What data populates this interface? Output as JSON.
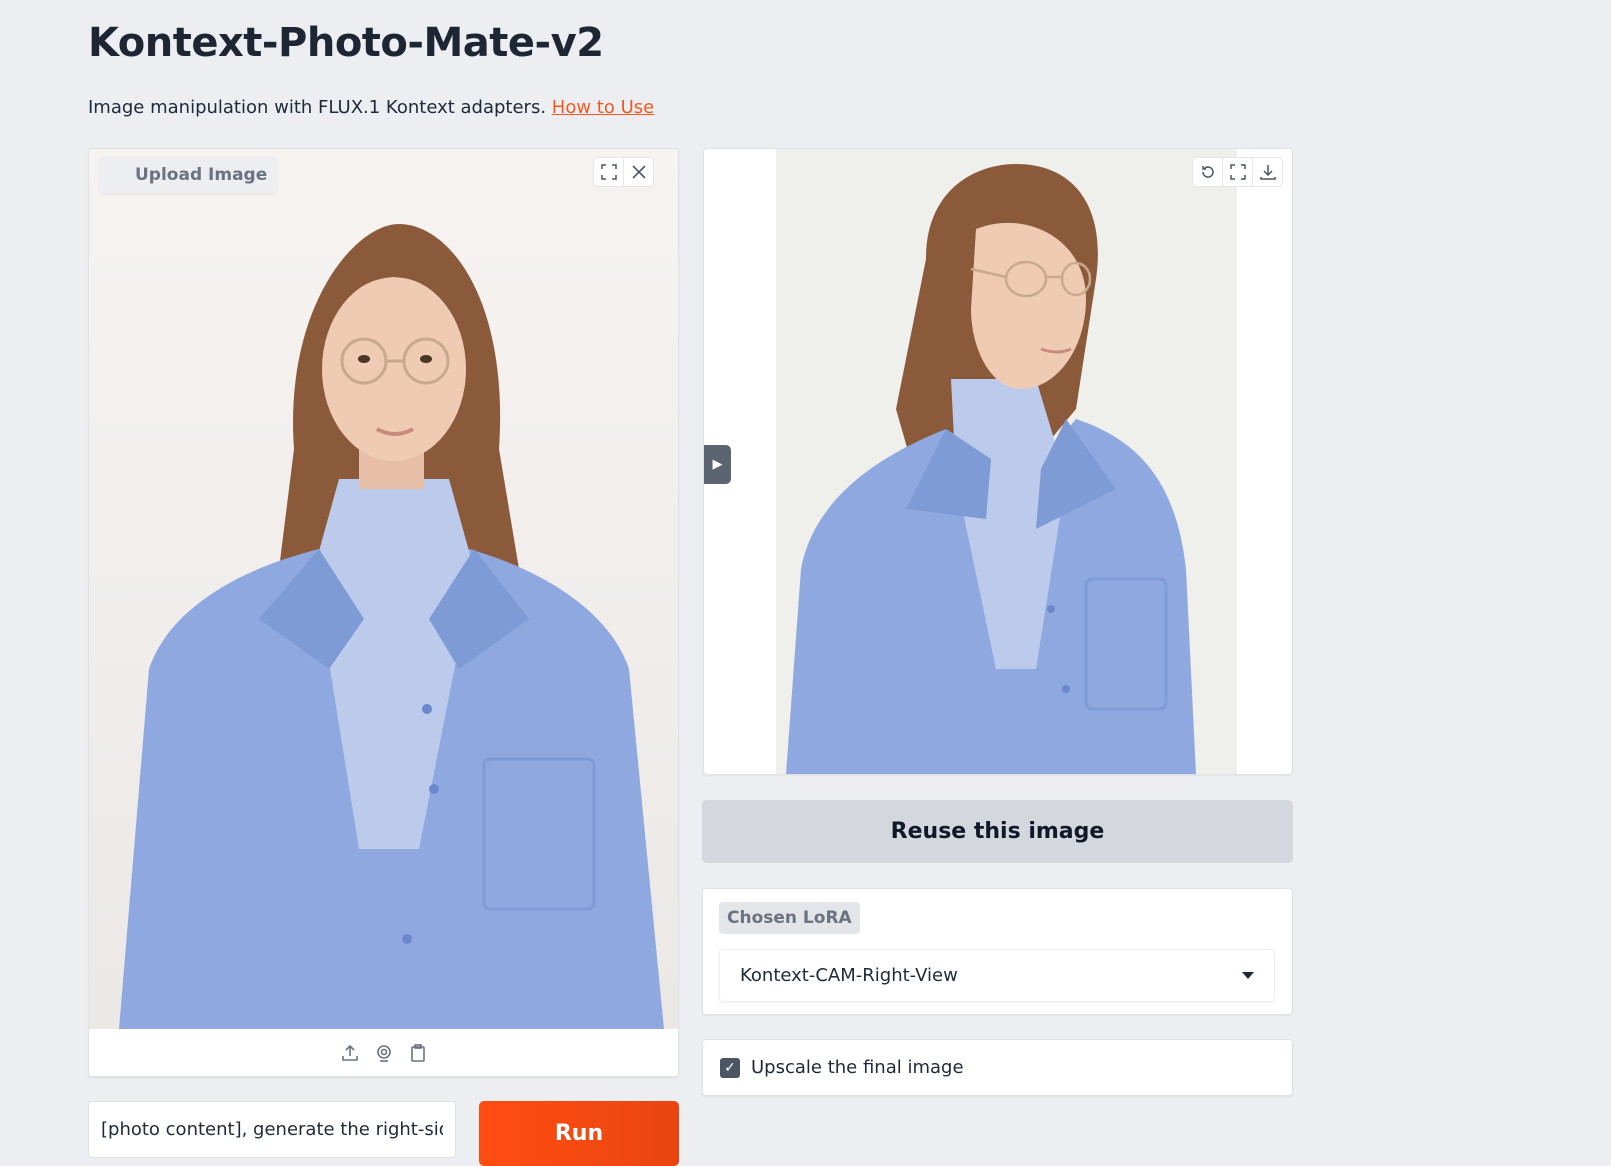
{
  "header": {
    "title": "Kontext-Photo-Mate-v2",
    "subtitle": "Image manipulation with FLUX.1 Kontext adapters.",
    "how_to_link": "How to Use"
  },
  "input_image": {
    "label": "Upload Image",
    "top_icons": [
      "fullscreen-icon",
      "close-icon"
    ],
    "toolbar_icons": [
      "upload-icon",
      "webcam-icon",
      "clipboard-icon"
    ]
  },
  "output_image": {
    "top_icons": [
      "undo-icon",
      "fullscreen-icon",
      "download-icon"
    ]
  },
  "reuse_button": "Reuse this image",
  "lora": {
    "label": "Chosen LoRA",
    "selected": "Kontext-CAM-Right-View"
  },
  "upscale": {
    "label": "Upscale the final image",
    "checked": true
  },
  "prompt": {
    "value": "[photo content], generate the right-sid"
  },
  "run_button": "Run",
  "colors": {
    "accent": "#ff4d12",
    "link": "#f05a1e",
    "background": "#eceef1"
  }
}
